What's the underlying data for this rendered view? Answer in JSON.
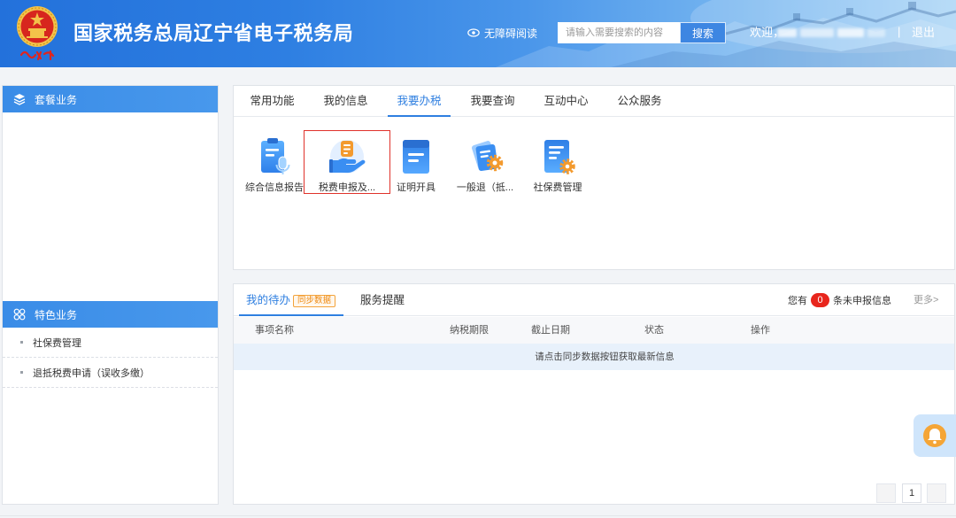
{
  "header": {
    "title": "国家税务总局辽宁省电子税务局",
    "emblem_icon": "national-tax-emblem",
    "accessibility": {
      "label": "无障碍阅读",
      "icon": "eye-icon"
    },
    "search": {
      "placeholder": "请输入需要搜索的内容",
      "value": "",
      "button_label": "搜索"
    },
    "welcome_label": "欢迎，",
    "separator": "|",
    "logout_label": "退出"
  },
  "sidebar": {
    "sections": [
      {
        "title": "套餐业务",
        "icon": "layers-icon",
        "items": []
      },
      {
        "title": "特色业务",
        "icon": "grid-icon",
        "items": [
          {
            "label": "社保费管理"
          },
          {
            "label": "退抵税费申请（误收多缴）"
          }
        ]
      }
    ]
  },
  "main": {
    "tabs": [
      {
        "label": "常用功能"
      },
      {
        "label": "我的信息"
      },
      {
        "label": "我要办税",
        "active": true
      },
      {
        "label": "我要查询"
      },
      {
        "label": "互动中心"
      },
      {
        "label": "公众服务"
      }
    ],
    "functions": [
      {
        "label": "综合信息报告",
        "icon": "report-microphone-icon"
      },
      {
        "label": "税费申报及...",
        "icon": "hand-coin-icon",
        "highlighted": true
      },
      {
        "label": "证明开具",
        "icon": "certificate-clipboard-icon"
      },
      {
        "label": "一般退（抵...",
        "icon": "refund-cards-gear-icon"
      },
      {
        "label": "社保费管理",
        "icon": "document-gear-icon"
      }
    ]
  },
  "todo": {
    "tabs": [
      {
        "label": "我的待办",
        "active": true,
        "badge": "同步数据"
      },
      {
        "label": "服务提醒"
      }
    ],
    "notice": {
      "prefix": "您有",
      "count": 0,
      "suffix": "条未申报信息"
    },
    "more_label": "更多>",
    "table": {
      "columns": [
        "事项名称",
        "纳税期限",
        "截止日期",
        "状态",
        "操作"
      ],
      "rows": [],
      "empty_message": "请点击同步数据按钮获取最新信息"
    },
    "pagination": {
      "current_page": 1
    }
  },
  "floating_button": {
    "icon": "bell-icon"
  },
  "colors": {
    "header_blue": "#2371db",
    "primary": "#2f7fe0",
    "section_header": "#3a8ce7",
    "badge_orange": "#f3a33b",
    "count_red": "#e8261d",
    "highlight_box": "#e0322b",
    "empty_row_bg": "#e8f1fb"
  }
}
